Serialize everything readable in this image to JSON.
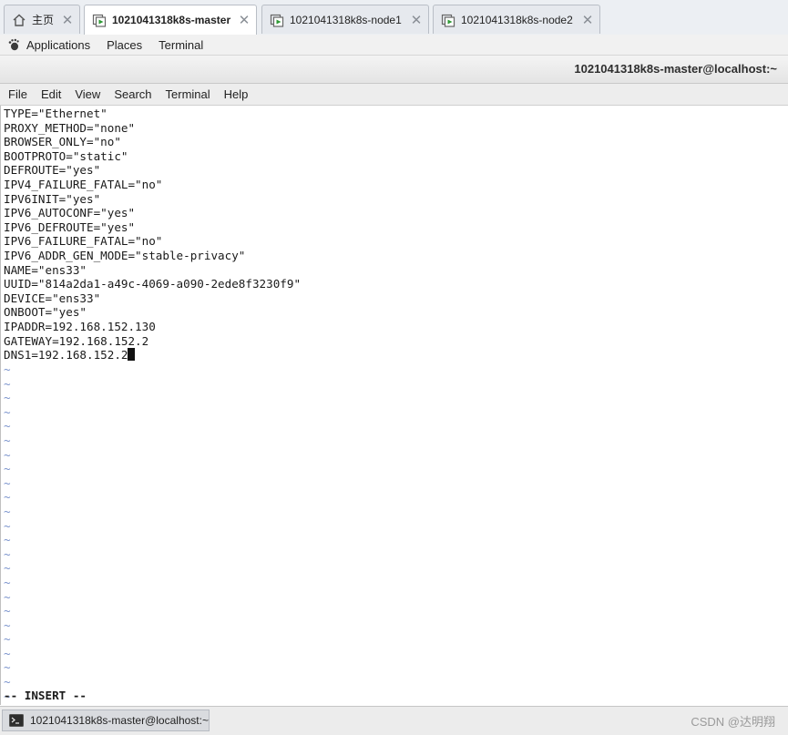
{
  "tabs": [
    {
      "label": "主页",
      "icon": "home-icon",
      "active": false
    },
    {
      "label": "1021041318k8s-master",
      "icon": "vm-icon",
      "active": true
    },
    {
      "label": "1021041318k8s-node1",
      "icon": "vm-icon",
      "active": false
    },
    {
      "label": "1021041318k8s-node2",
      "icon": "vm-icon",
      "active": false
    }
  ],
  "gnome_bar": {
    "applications": "Applications",
    "places": "Places",
    "terminal": "Terminal"
  },
  "window": {
    "title": "1021041318k8s-master@localhost:~"
  },
  "menu": [
    "File",
    "Edit",
    "View",
    "Search",
    "Terminal",
    "Help"
  ],
  "terminal": {
    "lines": [
      "TYPE=\"Ethernet\"",
      "PROXY_METHOD=\"none\"",
      "BROWSER_ONLY=\"no\"",
      "BOOTPROTO=\"static\"",
      "DEFROUTE=\"yes\"",
      "IPV4_FAILURE_FATAL=\"no\"",
      "IPV6INIT=\"yes\"",
      "IPV6_AUTOCONF=\"yes\"",
      "IPV6_DEFROUTE=\"yes\"",
      "IPV6_FAILURE_FATAL=\"no\"",
      "IPV6_ADDR_GEN_MODE=\"stable-privacy\"",
      "NAME=\"ens33\"",
      "UUID=\"814a2da1-a49c-4069-a090-2ede8f3230f9\"",
      "DEVICE=\"ens33\"",
      "ONBOOT=\"yes\"",
      "IPADDR=192.168.152.130",
      "GATEWAY=192.168.152.2",
      "DNS1=192.168.152.2"
    ],
    "empty_line_marker": "~",
    "mode": "-- INSERT --"
  },
  "taskbar": {
    "item": "1021041318k8s-master@localhost:~"
  },
  "watermark": "CSDN @达明翔",
  "colors": {
    "tilde": "#7a93cc",
    "background": "#ffffff"
  }
}
